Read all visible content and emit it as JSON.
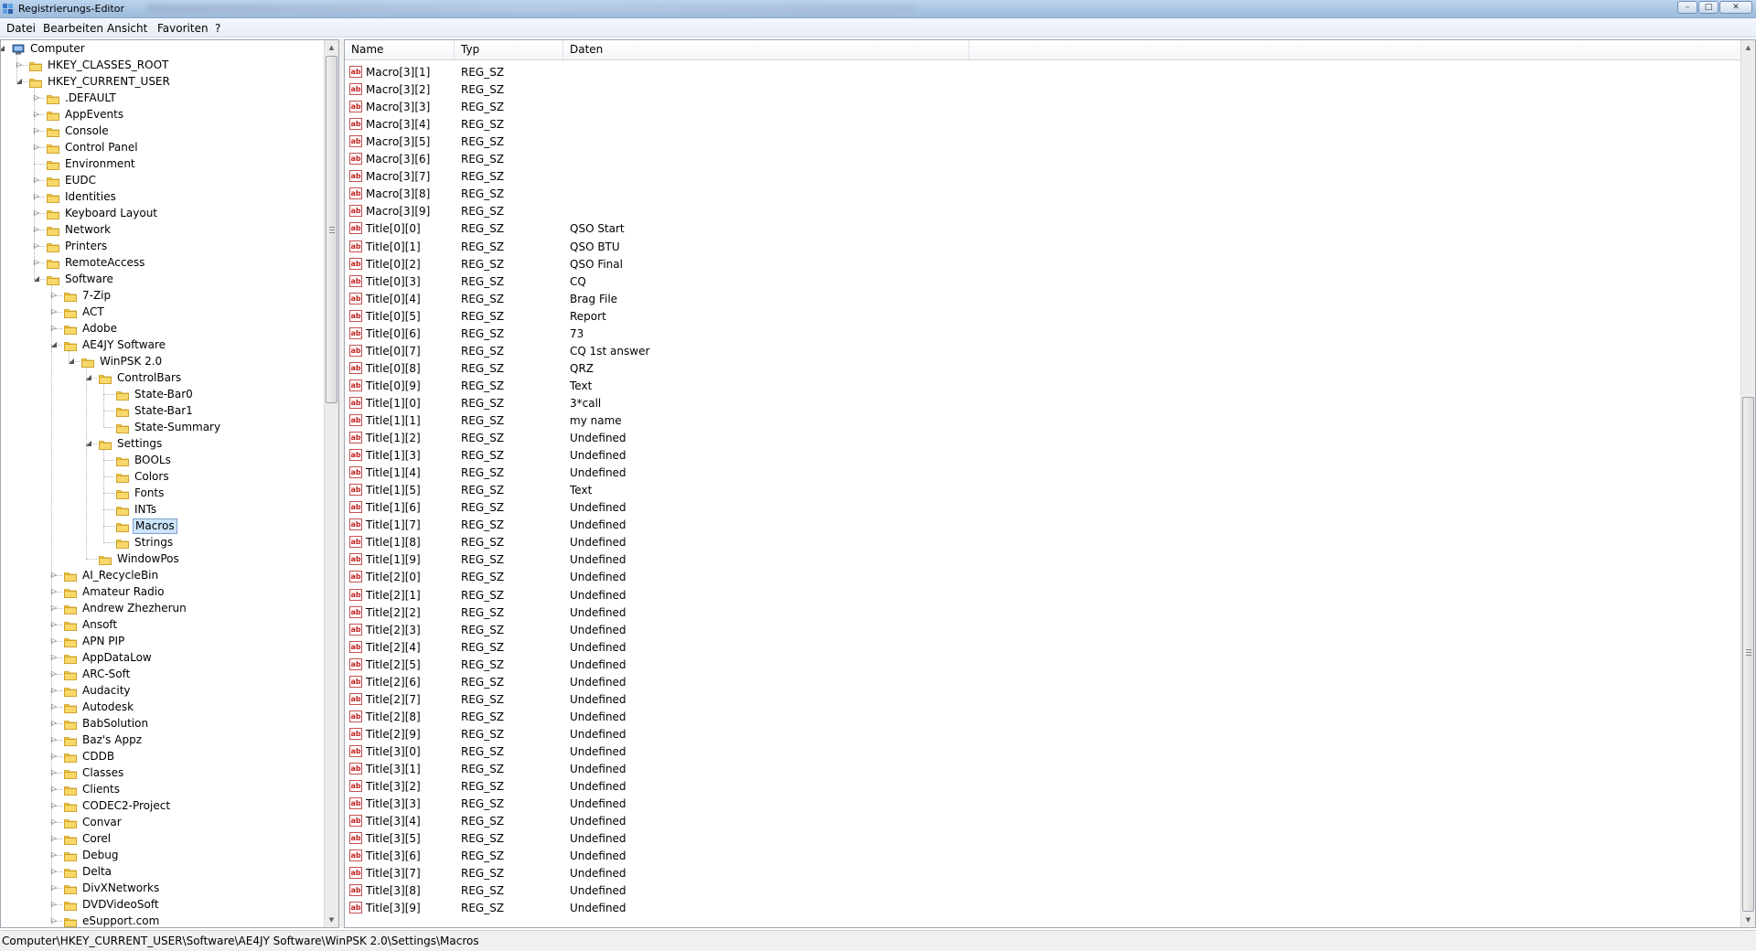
{
  "window": {
    "title": "Registrierungs-Editor",
    "controls": {
      "minimize": "minimize-icon",
      "maximize": "maximize-icon",
      "close": "close-icon"
    }
  },
  "menu": [
    "Datei",
    "Bearbeiten",
    "Ansicht",
    "Favoriten",
    "?"
  ],
  "tree": [
    {
      "label": "Computer",
      "level": 0,
      "state": "expanded",
      "icon": "computer-icon"
    },
    {
      "label": "HKEY_CLASSES_ROOT",
      "level": 1,
      "state": "collapsed"
    },
    {
      "label": "HKEY_CURRENT_USER",
      "level": 1,
      "state": "expanded"
    },
    {
      "label": ".DEFAULT",
      "level": 2,
      "state": "collapsed"
    },
    {
      "label": "AppEvents",
      "level": 2,
      "state": "collapsed"
    },
    {
      "label": "Console",
      "level": 2,
      "state": "collapsed"
    },
    {
      "label": "Control Panel",
      "level": 2,
      "state": "collapsed"
    },
    {
      "label": "Environment",
      "level": 2,
      "state": "leaf"
    },
    {
      "label": "EUDC",
      "level": 2,
      "state": "collapsed"
    },
    {
      "label": "Identities",
      "level": 2,
      "state": "collapsed"
    },
    {
      "label": "Keyboard Layout",
      "level": 2,
      "state": "collapsed"
    },
    {
      "label": "Network",
      "level": 2,
      "state": "collapsed"
    },
    {
      "label": "Printers",
      "level": 2,
      "state": "collapsed"
    },
    {
      "label": "RemoteAccess",
      "level": 2,
      "state": "collapsed"
    },
    {
      "label": "Software",
      "level": 2,
      "state": "expanded"
    },
    {
      "label": "7-Zip",
      "level": 3,
      "state": "collapsed"
    },
    {
      "label": "ACT",
      "level": 3,
      "state": "collapsed"
    },
    {
      "label": "Adobe",
      "level": 3,
      "state": "collapsed"
    },
    {
      "label": "AE4JY Software",
      "level": 3,
      "state": "expanded"
    },
    {
      "label": "WinPSK 2.0",
      "level": 4,
      "state": "expanded"
    },
    {
      "label": "ControlBars",
      "level": 5,
      "state": "expanded"
    },
    {
      "label": "State-Bar0",
      "level": 6,
      "state": "leaf"
    },
    {
      "label": "State-Bar1",
      "level": 6,
      "state": "leaf"
    },
    {
      "label": "State-Summary",
      "level": 6,
      "state": "leaf"
    },
    {
      "label": "Settings",
      "level": 5,
      "state": "expanded"
    },
    {
      "label": "BOOLs",
      "level": 6,
      "state": "leaf"
    },
    {
      "label": "Colors",
      "level": 6,
      "state": "leaf"
    },
    {
      "label": "Fonts",
      "level": 6,
      "state": "leaf"
    },
    {
      "label": "INTs",
      "level": 6,
      "state": "leaf"
    },
    {
      "label": "Macros",
      "level": 6,
      "state": "leaf",
      "selected": true
    },
    {
      "label": "Strings",
      "level": 6,
      "state": "leaf"
    },
    {
      "label": "WindowPos",
      "level": 5,
      "state": "leaf"
    },
    {
      "label": "AI_RecycleBin",
      "level": 3,
      "state": "collapsed"
    },
    {
      "label": "Amateur Radio",
      "level": 3,
      "state": "collapsed"
    },
    {
      "label": "Andrew Zhezherun",
      "level": 3,
      "state": "collapsed"
    },
    {
      "label": "Ansoft",
      "level": 3,
      "state": "collapsed"
    },
    {
      "label": "APN PIP",
      "level": 3,
      "state": "collapsed"
    },
    {
      "label": "AppDataLow",
      "level": 3,
      "state": "collapsed"
    },
    {
      "label": "ARC-Soft",
      "level": 3,
      "state": "collapsed"
    },
    {
      "label": "Audacity",
      "level": 3,
      "state": "collapsed"
    },
    {
      "label": "Autodesk",
      "level": 3,
      "state": "collapsed"
    },
    {
      "label": "BabSolution",
      "level": 3,
      "state": "collapsed"
    },
    {
      "label": "Baz's Appz",
      "level": 3,
      "state": "collapsed"
    },
    {
      "label": "CDDB",
      "level": 3,
      "state": "collapsed"
    },
    {
      "label": "Classes",
      "level": 3,
      "state": "collapsed"
    },
    {
      "label": "Clients",
      "level": 3,
      "state": "collapsed"
    },
    {
      "label": "CODEC2-Project",
      "level": 3,
      "state": "collapsed"
    },
    {
      "label": "Convar",
      "level": 3,
      "state": "collapsed"
    },
    {
      "label": "Corel",
      "level": 3,
      "state": "collapsed"
    },
    {
      "label": "Debug",
      "level": 3,
      "state": "collapsed"
    },
    {
      "label": "Delta",
      "level": 3,
      "state": "collapsed"
    },
    {
      "label": "DivXNetworks",
      "level": 3,
      "state": "collapsed"
    },
    {
      "label": "DVDVideoSoft",
      "level": 3,
      "state": "collapsed"
    },
    {
      "label": "eSupport.com",
      "level": 3,
      "state": "collapsed"
    }
  ],
  "columns": {
    "name": "Name",
    "type": "Typ",
    "data": "Daten"
  },
  "values": [
    {
      "name": "Macro[3][1]",
      "type": "REG_SZ",
      "data": ""
    },
    {
      "name": "Macro[3][2]",
      "type": "REG_SZ",
      "data": ""
    },
    {
      "name": "Macro[3][3]",
      "type": "REG_SZ",
      "data": ""
    },
    {
      "name": "Macro[3][4]",
      "type": "REG_SZ",
      "data": ""
    },
    {
      "name": "Macro[3][5]",
      "type": "REG_SZ",
      "data": ""
    },
    {
      "name": "Macro[3][6]",
      "type": "REG_SZ",
      "data": ""
    },
    {
      "name": "Macro[3][7]",
      "type": "REG_SZ",
      "data": ""
    },
    {
      "name": "Macro[3][8]",
      "type": "REG_SZ",
      "data": ""
    },
    {
      "name": "Macro[3][9]",
      "type": "REG_SZ",
      "data": ""
    },
    {
      "name": "Title[0][0]",
      "type": "REG_SZ",
      "data": "QSO Start"
    },
    {
      "name": "Title[0][1]",
      "type": "REG_SZ",
      "data": "QSO BTU"
    },
    {
      "name": "Title[0][2]",
      "type": "REG_SZ",
      "data": "QSO Final"
    },
    {
      "name": "Title[0][3]",
      "type": "REG_SZ",
      "data": "CQ"
    },
    {
      "name": "Title[0][4]",
      "type": "REG_SZ",
      "data": "Brag File"
    },
    {
      "name": "Title[0][5]",
      "type": "REG_SZ",
      "data": "Report"
    },
    {
      "name": "Title[0][6]",
      "type": "REG_SZ",
      "data": "73"
    },
    {
      "name": "Title[0][7]",
      "type": "REG_SZ",
      "data": "CQ 1st answer"
    },
    {
      "name": "Title[0][8]",
      "type": "REG_SZ",
      "data": "QRZ"
    },
    {
      "name": "Title[0][9]",
      "type": "REG_SZ",
      "data": "Text"
    },
    {
      "name": "Title[1][0]",
      "type": "REG_SZ",
      "data": "3*call"
    },
    {
      "name": "Title[1][1]",
      "type": "REG_SZ",
      "data": "my name"
    },
    {
      "name": "Title[1][2]",
      "type": "REG_SZ",
      "data": "Undefined"
    },
    {
      "name": "Title[1][3]",
      "type": "REG_SZ",
      "data": "Undefined"
    },
    {
      "name": "Title[1][4]",
      "type": "REG_SZ",
      "data": "Undefined"
    },
    {
      "name": "Title[1][5]",
      "type": "REG_SZ",
      "data": "Text"
    },
    {
      "name": "Title[1][6]",
      "type": "REG_SZ",
      "data": "Undefined"
    },
    {
      "name": "Title[1][7]",
      "type": "REG_SZ",
      "data": "Undefined"
    },
    {
      "name": "Title[1][8]",
      "type": "REG_SZ",
      "data": "Undefined"
    },
    {
      "name": "Title[1][9]",
      "type": "REG_SZ",
      "data": "Undefined"
    },
    {
      "name": "Title[2][0]",
      "type": "REG_SZ",
      "data": "Undefined"
    },
    {
      "name": "Title[2][1]",
      "type": "REG_SZ",
      "data": "Undefined"
    },
    {
      "name": "Title[2][2]",
      "type": "REG_SZ",
      "data": "Undefined"
    },
    {
      "name": "Title[2][3]",
      "type": "REG_SZ",
      "data": "Undefined"
    },
    {
      "name": "Title[2][4]",
      "type": "REG_SZ",
      "data": "Undefined"
    },
    {
      "name": "Title[2][5]",
      "type": "REG_SZ",
      "data": "Undefined"
    },
    {
      "name": "Title[2][6]",
      "type": "REG_SZ",
      "data": "Undefined"
    },
    {
      "name": "Title[2][7]",
      "type": "REG_SZ",
      "data": "Undefined"
    },
    {
      "name": "Title[2][8]",
      "type": "REG_SZ",
      "data": "Undefined"
    },
    {
      "name": "Title[2][9]",
      "type": "REG_SZ",
      "data": "Undefined"
    },
    {
      "name": "Title[3][0]",
      "type": "REG_SZ",
      "data": "Undefined"
    },
    {
      "name": "Title[3][1]",
      "type": "REG_SZ",
      "data": "Undefined"
    },
    {
      "name": "Title[3][2]",
      "type": "REG_SZ",
      "data": "Undefined"
    },
    {
      "name": "Title[3][3]",
      "type": "REG_SZ",
      "data": "Undefined"
    },
    {
      "name": "Title[3][4]",
      "type": "REG_SZ",
      "data": "Undefined"
    },
    {
      "name": "Title[3][5]",
      "type": "REG_SZ",
      "data": "Undefined"
    },
    {
      "name": "Title[3][6]",
      "type": "REG_SZ",
      "data": "Undefined"
    },
    {
      "name": "Title[3][7]",
      "type": "REG_SZ",
      "data": "Undefined"
    },
    {
      "name": "Title[3][8]",
      "type": "REG_SZ",
      "data": "Undefined"
    },
    {
      "name": "Title[3][9]",
      "type": "REG_SZ",
      "data": "Undefined"
    }
  ],
  "value_icon_text": "ab",
  "status": {
    "path": "Computer\\HKEY_CURRENT_USER\\Software\\AE4JY Software\\WinPSK 2.0\\Settings\\Macros"
  },
  "colors": {
    "selection": "#cce4fb",
    "folder": "#f3c93f",
    "titlebar": "#a9c4e2"
  }
}
